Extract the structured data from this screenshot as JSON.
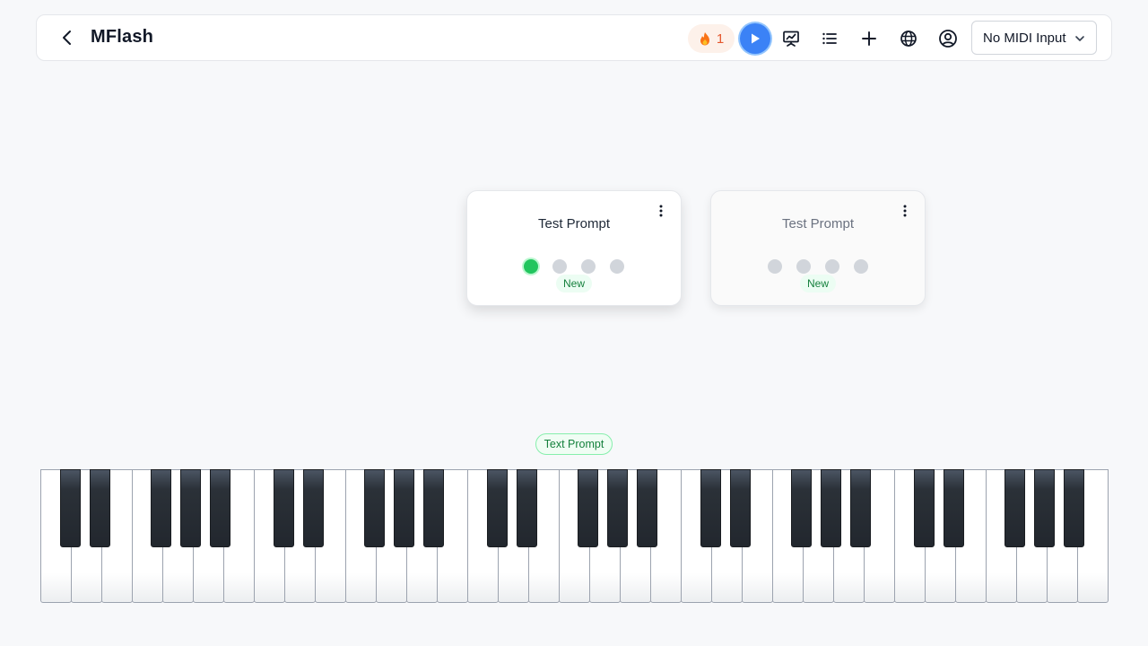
{
  "header": {
    "title": "MFlash",
    "streak_count": "1",
    "midi_input": "No MIDI Input",
    "icons": [
      "back-icon",
      "flame-icon",
      "play-icon",
      "chart-icon",
      "list-icon",
      "plus-icon",
      "globe-icon",
      "account-icon",
      "chevron-down-icon"
    ]
  },
  "cards": [
    {
      "title": "Test Prompt",
      "badge": "New",
      "progress_dots": [
        true,
        false,
        false,
        false
      ],
      "active": true
    },
    {
      "title": "Test Prompt",
      "badge": "New",
      "progress_dots": [
        false,
        false,
        false,
        false
      ],
      "active": false
    }
  ],
  "prompt_label": "Text Prompt",
  "keyboard": {
    "white_keys": 35,
    "octaves": 5
  },
  "colors": {
    "accent": "#3b82f6",
    "success": "#22c55e",
    "streak": "#e4572e"
  }
}
